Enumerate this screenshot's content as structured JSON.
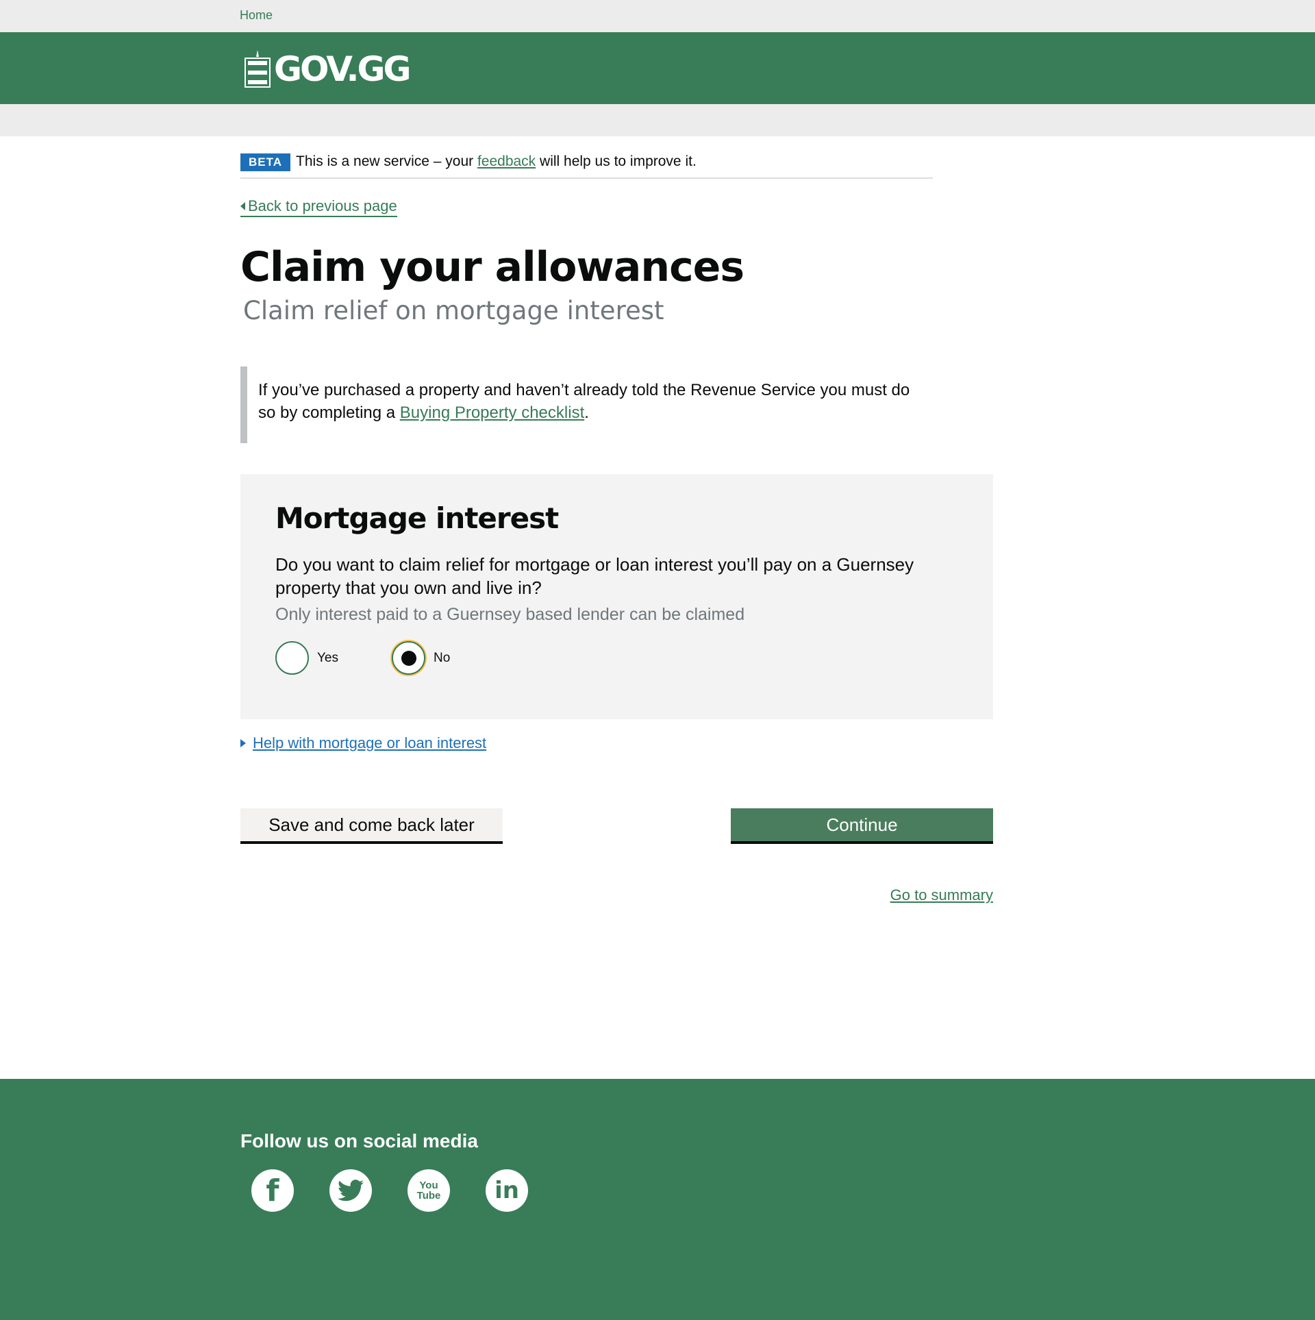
{
  "breadcrumb": {
    "home": "Home"
  },
  "header": {
    "logo_text": "GOV.GG"
  },
  "beta": {
    "tag": "BETA",
    "text_before": "This is a new service – your ",
    "link": "feedback",
    "text_after": " will help us to improve it."
  },
  "back_link": "Back to previous page",
  "title": "Claim your allowances",
  "subtitle": "Claim relief on mortgage interest",
  "inset": {
    "text_before": "If you’ve purchased a property and haven’t already told the Revenue Service you must do so by completing a ",
    "link": "Buying Property checklist",
    "text_after": "."
  },
  "panel": {
    "heading": "Mortgage interest",
    "question": "Do you want to claim relief for mortgage or loan interest you’ll pay on a Guernsey property that you own and live in?",
    "hint": "Only interest paid to a Guernsey based lender can be claimed",
    "options": [
      {
        "label": "Yes",
        "selected": false
      },
      {
        "label": "No",
        "selected": true
      }
    ]
  },
  "help_link": "Help with mortgage or loan interest",
  "buttons": {
    "save": "Save and come back later",
    "continue": "Continue"
  },
  "summary_link": "Go to summary",
  "footer": {
    "follow": "Follow us on social media",
    "social": [
      {
        "icon": "facebook-icon",
        "glyph": "f"
      },
      {
        "icon": "twitter-icon",
        "glyph": "🐦"
      },
      {
        "icon": "youtube-icon",
        "glyph": "You Tube"
      },
      {
        "icon": "linkedin-icon",
        "glyph": "in"
      }
    ]
  }
}
